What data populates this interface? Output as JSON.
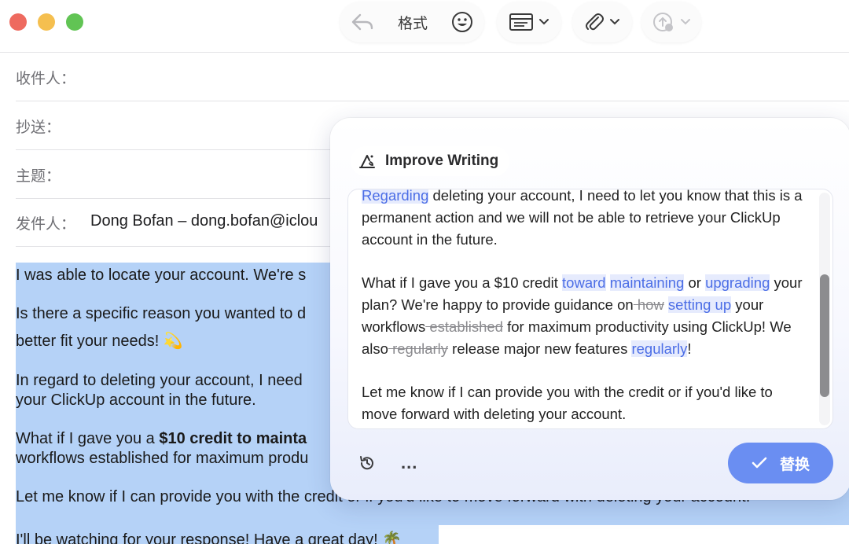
{
  "toolbar": {
    "format_label": "格式"
  },
  "header": {
    "to_label": "收件人：",
    "cc_label": "抄送：",
    "subject_label": "主题：",
    "from_label": "发件人：",
    "from_value": "Dong Bofan – dong.bofan@iclou"
  },
  "body": {
    "line1": "I was able to locate your account. We're s",
    "line2": "Is there a specific reason you wanted to d",
    "line3": "better fit your needs! 💫",
    "line4": "In regard to deleting your account, I need",
    "line5": "your ClickUp account in the future.",
    "line6_prefix": "What if I gave you a ",
    "line6_bold": "$10 credit to mainta",
    "line7": "workflows established for maximum produ",
    "line8": "Let me know if I can provide you with the credit or if you'd like to move forward with deleting your account.",
    "line9": "I'll be watching for your response! Have a great day! 🌴"
  },
  "panel": {
    "title": "Improve Writing",
    "p1": {
      "hl1": "Regarding",
      "t1": " deleting your account, I need to let you know that this is a permanent action and we will not be able to retrieve your ClickUp account in the future."
    },
    "p2": {
      "t1": "What if I gave you a $10 credit ",
      "hl1": "toward",
      "t2": " ",
      "hl2": "maintaining",
      "t3": " or ",
      "hl3": "upgrading",
      "t4": " your plan? We're happy to provide guidance on",
      "del1": " how",
      "t5": " ",
      "hl4": "setting up",
      "t6": " your workflows",
      "del2": " established",
      "t7": " for maximum productivity using ClickUp! We also",
      "del3": " regularly",
      "t8": " release major new features ",
      "hl5": "regularly",
      "t9": "!"
    },
    "p3": {
      "t1": "Let me know if I can provide you with the credit or if you'd like to move forward with deleting your account."
    },
    "more_label": "...",
    "replace_label": "替换"
  },
  "colors": {
    "accent": "#6a8ef2",
    "highlight_text": "#4c6ee6",
    "selection": "#b5d2f7"
  }
}
